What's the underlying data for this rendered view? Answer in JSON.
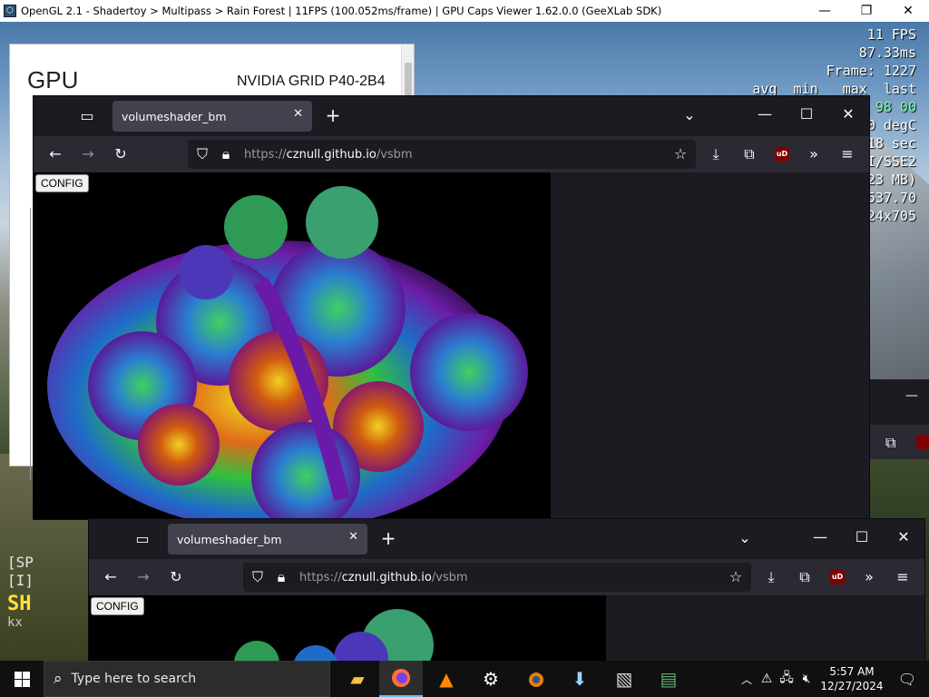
{
  "gpucaps": {
    "title": "OpenGL 2.1 - Shadertoy > Multipass > Rain Forest | 11FPS (100.052ms/frame) | GPU Caps Viewer 1.62.0.0 (GeeXLab SDK)",
    "app_icon": "geexlab-icon",
    "minimize_icon": "minimize-icon",
    "restore_icon": "restore-icon",
    "close_icon": "close-icon",
    "osd_lines": [
      "11 FPS",
      "87.33ms",
      "Frame: 1227",
      "avg  min   max  last",
      "98 00",
      "0 degC",
      "18 sec",
      "I/SSE2",
      "23 MB)",
      "537.70",
      "24x705"
    ],
    "osd_green_color": "#7dffb4",
    "gpu_label": "GPU",
    "gpu_value": "NVIDIA GRID P40-2B4",
    "term_lines": [
      "[SP",
      "[I]"
    ],
    "term_big": "SH",
    "term_small": "kx"
  },
  "browser_top": {
    "tab_title": "volumeshader_bm",
    "url_prefix": "https://",
    "url_host": "cznull.github.io",
    "url_path": "/vsbm",
    "config_label": "CONFIG",
    "ublock_label": "uD"
  },
  "browser_bottom": {
    "tab_title": "volumeshader_bm",
    "url_prefix": "https://",
    "url_host": "cznull.github.io",
    "url_path": "/vsbm",
    "config_label": "CONFIG",
    "ublock_label": "uD"
  },
  "taskbar": {
    "search_placeholder": "Type here to search",
    "apps": [
      "file-explorer-icon",
      "firefox-icon",
      "vlc-icon",
      "settings-icon",
      "blender-icon",
      "downloader-icon",
      "photos-icon",
      "gpu-caps-icon"
    ],
    "time": "5:57 AM",
    "date": "12/27/2024"
  },
  "colors": {
    "firefox_dark": "#1c1b22",
    "firefox_toolbar": "#2b2a33",
    "firefox_tab": "#42414d",
    "ublock_red": "#800000",
    "taskbar": "#101010",
    "highlight_blue": "#76b9ed"
  }
}
